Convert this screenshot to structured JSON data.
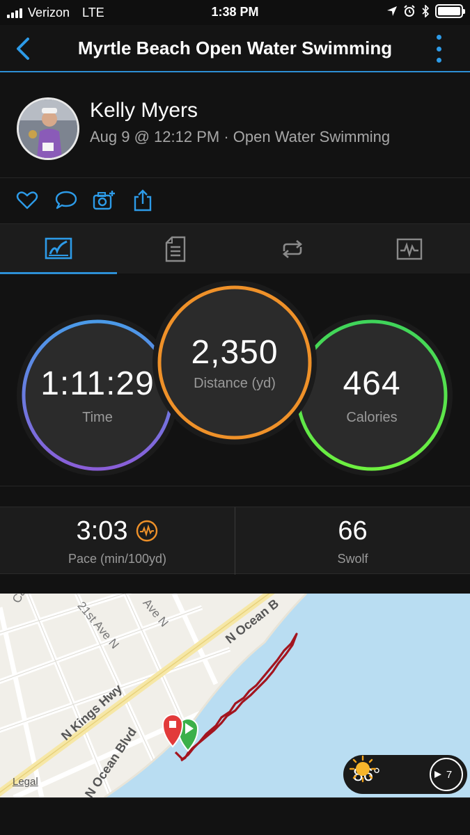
{
  "status_bar": {
    "carrier": "Verizon",
    "network": "LTE",
    "time": "1:38 PM"
  },
  "navbar": {
    "title": "Myrtle Beach Open Water Swimming",
    "accent": "#2d9be8"
  },
  "profile": {
    "name": "Kelly Myers",
    "meta": "Aug 9 @ 12:12 PM · Open Water Swimming"
  },
  "actions": [
    "heart-icon",
    "comment-icon",
    "add-photo-icon",
    "share-icon"
  ],
  "tabs": [
    "stats-tab-icon",
    "details-tab-icon",
    "laps-tab-icon",
    "graphs-tab-icon"
  ],
  "stats": {
    "time": {
      "value": "1:11:29",
      "label": "Time"
    },
    "distance": {
      "value": "2,350",
      "label": "Distance (yd)"
    },
    "calories": {
      "value": "464",
      "label": "Calories"
    }
  },
  "secondary": {
    "pace": {
      "value": "3:03",
      "label": "Pace (min/100yd)"
    },
    "swolf": {
      "value": "66",
      "label": "Swolf"
    }
  },
  "map": {
    "streets": [
      "Carver",
      "21st Ave N",
      "Ave N",
      "N Ocean B",
      "N Kings Hwy",
      "N Ocean Blvd"
    ],
    "legal": "Legal",
    "water_color": "#b9ddf2",
    "route_color": "#a3151f",
    "weather": {
      "temp": "86°",
      "wind": "7"
    }
  }
}
